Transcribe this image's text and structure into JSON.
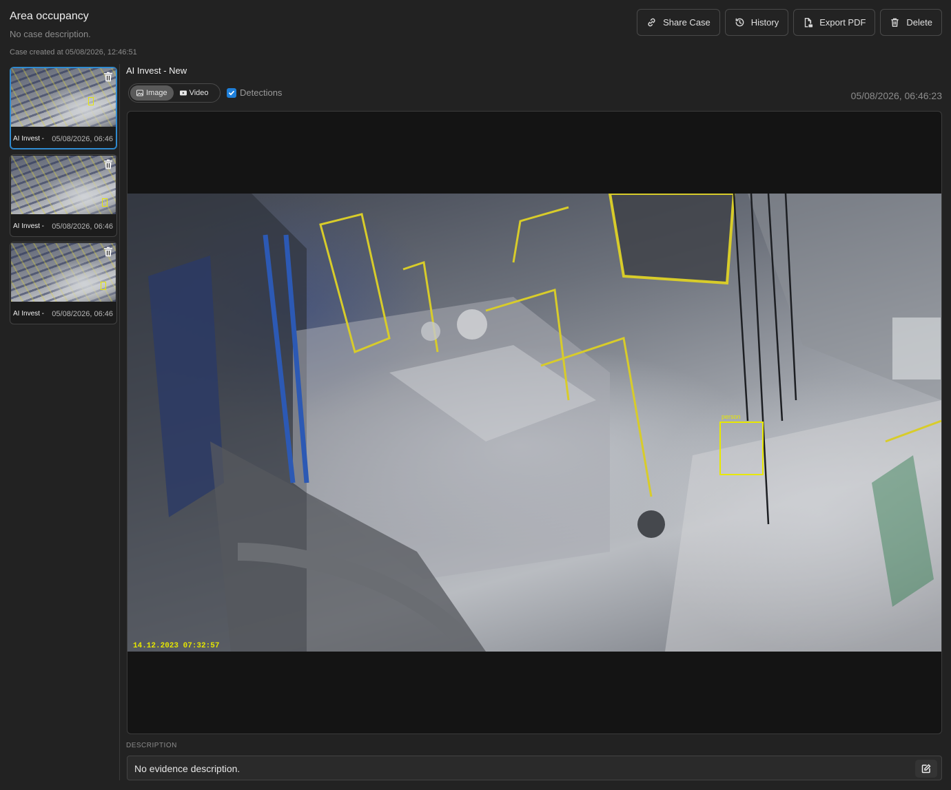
{
  "case": {
    "title": "Area occupancy",
    "description": "No case description.",
    "created": "Case created at 05/08/2026, 12:46:51"
  },
  "toolbar": {
    "share_label": "Share Case",
    "history_label": "History",
    "export_label": "Export PDF",
    "delete_label": "Delete"
  },
  "evidence_list": [
    {
      "camera": "AI Invest - New",
      "timestamp": "05/08/2026, 06:46",
      "active": true
    },
    {
      "camera": "AI Invest - New",
      "timestamp": "05/08/2026, 06:46",
      "active": false
    },
    {
      "camera": "AI Invest - New",
      "timestamp": "05/08/2026, 06:46",
      "active": false
    }
  ],
  "evidence": {
    "camera_name": "AI Invest - New",
    "mode_image_label": "Image",
    "mode_video_label": "Video",
    "active_mode": "Image",
    "detections_label": "Detections",
    "detections_checked": true,
    "timestamp": "05/08/2026, 06:46:23",
    "frame_overlay_timestamp": "14.12.2023 07:32:57",
    "detection_label": "person"
  },
  "description_section": {
    "label": "DESCRIPTION",
    "text": "No evidence description."
  },
  "colors": {
    "accent": "#1e7fd9",
    "detection_box": "#e8e800",
    "background": "#222222"
  }
}
